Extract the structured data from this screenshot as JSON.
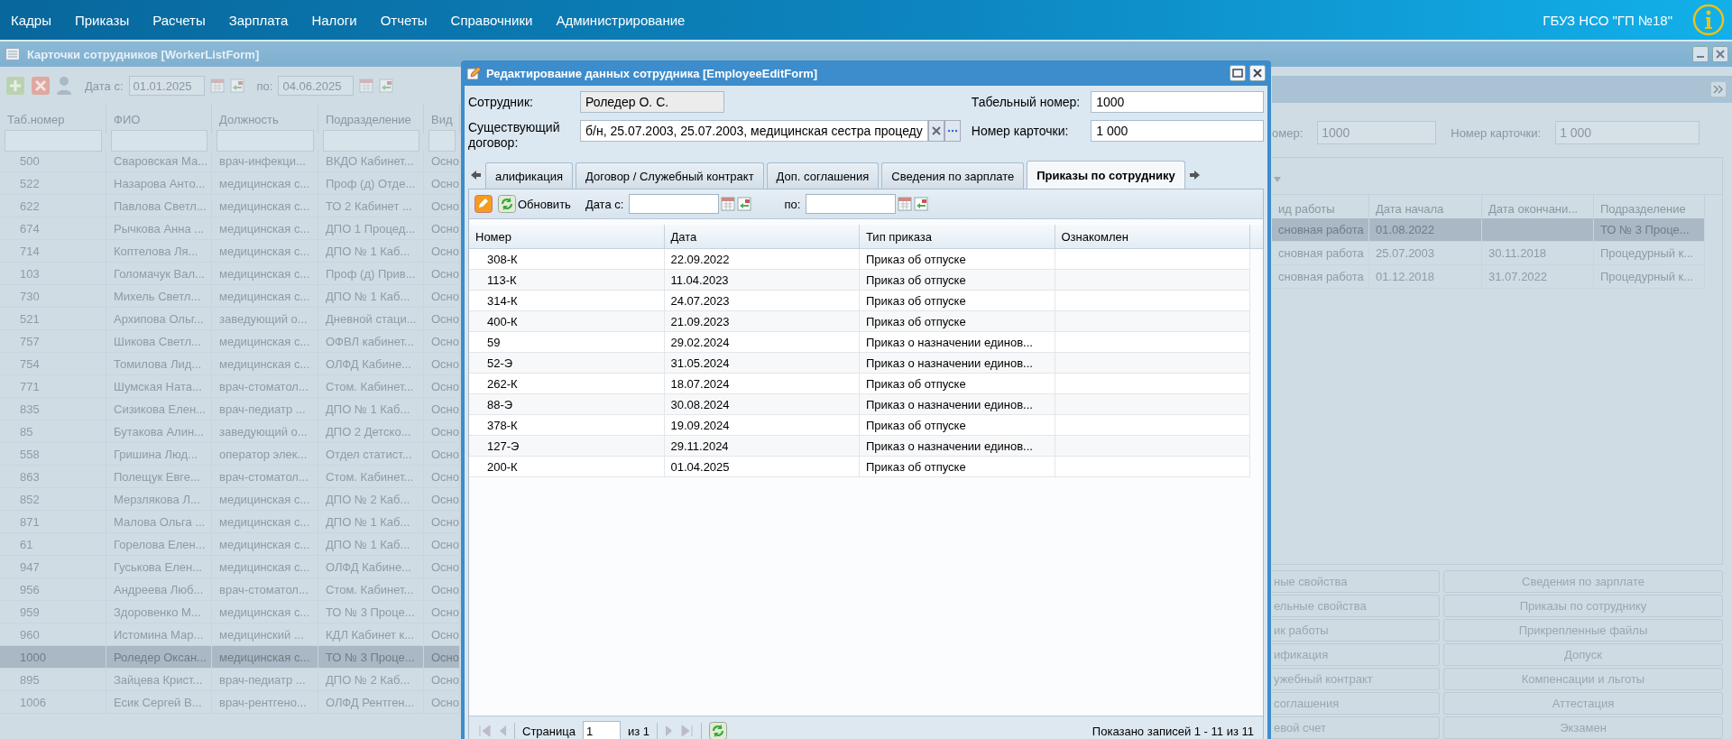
{
  "menu_bar": {
    "items": [
      "Кадры",
      "Приказы",
      "Расчеты",
      "Зарплата",
      "Налоги",
      "Отчеты",
      "Справочники",
      "Администрирование"
    ],
    "organization": "ГБУЗ НСО \"ГП №18\""
  },
  "worker_list_window": {
    "title": "Карточки сотрудников [WorkerListForm]",
    "toolbar": {
      "date_from_label": "Дата с:",
      "date_from": "01.01.2025",
      "date_to_label": "по:",
      "date_to": "04.06.2025"
    },
    "table": {
      "columns": [
        "Таб.номер",
        "ФИО",
        "Должность",
        "Подразделение",
        "Вид"
      ],
      "rows": [
        {
          "cells": [
            "500",
            "Сваровская Ма...",
            "врач-инфекци...",
            "ВКДО Кабинет...",
            "Осно"
          ],
          "selected": false
        },
        {
          "cells": [
            "522",
            "Назарова Анто...",
            "медицинская с...",
            "Проф (д) Отде...",
            "Осно"
          ],
          "selected": false
        },
        {
          "cells": [
            "622",
            "Павлова Светл...",
            "медицинская с...",
            "ТО 2 Кабинет ...",
            "Осно"
          ],
          "selected": false
        },
        {
          "cells": [
            "674",
            "Рычкова Анна ...",
            "медицинская с...",
            "ДПО 1 Процед...",
            "Осно"
          ],
          "selected": false
        },
        {
          "cells": [
            "714",
            "Коптелова Ля...",
            "медицинская с...",
            "ДПО № 1 Каб...",
            "Осно"
          ],
          "selected": false
        },
        {
          "cells": [
            "103",
            "Голомачук Вал...",
            "медицинская с...",
            "Проф (д) Прив...",
            "Осно"
          ],
          "selected": false
        },
        {
          "cells": [
            "730",
            "Михель Светл...",
            "медицинская с...",
            "ДПО № 1 Каб...",
            "Осно"
          ],
          "selected": false
        },
        {
          "cells": [
            "521",
            "Архипова Ольг...",
            "заведующий о...",
            "Дневной стаци...",
            "Осно"
          ],
          "selected": false
        },
        {
          "cells": [
            "757",
            "Шикова Светл...",
            "медицинская с...",
            "ОФВЛ кабинет...",
            "Осно"
          ],
          "selected": false
        },
        {
          "cells": [
            "754",
            "Томилова Лид...",
            "медицинская с...",
            "ОЛФД Кабине...",
            "Осно"
          ],
          "selected": false
        },
        {
          "cells": [
            "771",
            "Шумская Ната...",
            "врач-стоматол...",
            "Стом. Кабинет...",
            "Осно"
          ],
          "selected": false
        },
        {
          "cells": [
            "835",
            "Сизикова Елен...",
            "врач-педиатр ...",
            "ДПО № 1 Каб...",
            "Осно"
          ],
          "selected": false
        },
        {
          "cells": [
            "85",
            "Бутакова Алин...",
            "заведующий о...",
            "ДПО 2 Детско...",
            "Осно"
          ],
          "selected": false
        },
        {
          "cells": [
            "558",
            "Гришина Люд...",
            "оператор элек...",
            "Отдел статист...",
            "Осно"
          ],
          "selected": false
        },
        {
          "cells": [
            "863",
            "Полещук Евге...",
            "врач-стоматол...",
            "Стом. Кабинет...",
            "Осно"
          ],
          "selected": false
        },
        {
          "cells": [
            "852",
            "Мерзлякова Л...",
            "медицинская с...",
            "ДПО № 2 Каб...",
            "Осно"
          ],
          "selected": false
        },
        {
          "cells": [
            "871",
            "Малова Ольга ...",
            "медицинская с...",
            "ДПО № 1 Каб...",
            "Осно"
          ],
          "selected": false
        },
        {
          "cells": [
            "61",
            "Горелова Елен...",
            "медицинская с...",
            "ДПО № 1 Каб...",
            "Осно"
          ],
          "selected": false
        },
        {
          "cells": [
            "947",
            "Гуськова Елен...",
            "медицинская с...",
            "ОЛФД Кабине...",
            "Осно"
          ],
          "selected": false
        },
        {
          "cells": [
            "956",
            "Андреева Люб...",
            "врач-стоматол...",
            "Стом. Кабинет...",
            "Осно"
          ],
          "selected": false
        },
        {
          "cells": [
            "959",
            "Здоровенко М...",
            "медицинская с...",
            "ТО № 3 Проце...",
            "Осно"
          ],
          "selected": false
        },
        {
          "cells": [
            "960",
            "Истомина Мар...",
            "медицинский ...",
            "КДЛ Кабинет к...",
            "Осно"
          ],
          "selected": false
        },
        {
          "cells": [
            "1000",
            "Роледер Оксан...",
            "медицинская с...",
            "ТО № 3 Проце...",
            "Осно"
          ],
          "selected": true
        },
        {
          "cells": [
            "895",
            "Зайцева Крист...",
            "врач-педиатр ...",
            "ДПО № 2 Каб...",
            "Осно"
          ],
          "selected": false
        },
        {
          "cells": [
            "1006",
            "Есик Сергей В...",
            "врач-рентгено...",
            "ОЛФД Рентген...",
            "Осно"
          ],
          "selected": false
        }
      ]
    }
  },
  "details_panel": {
    "fields": [
      {
        "label": "омер:",
        "value": "1000"
      },
      {
        "label": "Номер карточки:",
        "value": "1 000"
      }
    ],
    "table": {
      "columns": [
        "ид работы",
        "Дата начала",
        "Дата окончани...",
        "Подразделение"
      ],
      "rows": [
        {
          "cells": [
            "сновная работа",
            "01.08.2022",
            "",
            "ТО № 3 Проце..."
          ],
          "selected": true
        },
        {
          "cells": [
            "сновная работа",
            "25.07.2003",
            "30.11.2018",
            "Процедурный к..."
          ],
          "selected": false
        },
        {
          "cells": [
            "сновная работа",
            "01.12.2018",
            "31.07.2022",
            "Процедурный к..."
          ],
          "selected": false
        }
      ]
    },
    "buttons": [
      "ные свойства",
      "Сведения по зарплате",
      "ельные свойства",
      "Приказы по сотруднику",
      "ик работы",
      "Прикрепленные файлы",
      "ификация",
      "Допуск",
      "ужебный контракт",
      "Компенсации и льготы",
      "соглашения",
      "Аттестация",
      "евой счет",
      "Экзамен"
    ]
  },
  "edit_dialog": {
    "title": "Редактирование данных сотрудника [EmployeeEditForm]",
    "employee_label": "Сотрудник:",
    "employee": "Роледер О. С.",
    "tab_number_label": "Табельный номер:",
    "tab_number": "1000",
    "contract_label": "Существующий договор:",
    "contract": "б/н, 25.07.2003, 25.07.2003, медицинская сестра процеду",
    "card_number_label": "Номер карточки:",
    "card_number": "1 000",
    "tabs": [
      {
        "label": "алификация",
        "selected": false
      },
      {
        "label": "Договор / Служебный контракт",
        "selected": false
      },
      {
        "label": "Доп. соглашения",
        "selected": false
      },
      {
        "label": "Сведения по зарплате",
        "selected": false
      },
      {
        "label": "Приказы по сотруднику",
        "selected": true
      }
    ],
    "toolbar": {
      "refresh_label": "Обновить",
      "date_from_label": "Дата с:",
      "date_to_label": "по:"
    },
    "table": {
      "columns": [
        "Номер",
        "Дата",
        "Тип приказа",
        "Ознакомлен"
      ],
      "rows": [
        {
          "cells": [
            "308-К",
            "22.09.2022",
            "Приказ об отпуске",
            ""
          ]
        },
        {
          "cells": [
            "113-К",
            "11.04.2023",
            "Приказ об отпуске",
            ""
          ]
        },
        {
          "cells": [
            "314-К",
            "24.07.2023",
            "Приказ об отпуске",
            ""
          ]
        },
        {
          "cells": [
            "400-К",
            "21.09.2023",
            "Приказ об отпуске",
            ""
          ]
        },
        {
          "cells": [
            "59",
            "29.02.2024",
            "Приказ о назначении единов...",
            ""
          ]
        },
        {
          "cells": [
            "52-Э",
            "31.05.2024",
            "Приказ о назначении единов...",
            ""
          ]
        },
        {
          "cells": [
            "262-К",
            "18.07.2024",
            "Приказ об отпуске",
            ""
          ]
        },
        {
          "cells": [
            "88-Э",
            "30.08.2024",
            "Приказ о назначении единов...",
            ""
          ]
        },
        {
          "cells": [
            "378-К",
            "19.09.2024",
            "Приказ об отпуске",
            ""
          ]
        },
        {
          "cells": [
            "127-Э",
            "29.11.2024",
            "Приказ о назначении единов...",
            ""
          ]
        },
        {
          "cells": [
            "200-К",
            "01.04.2025",
            "Приказ об отпуске",
            ""
          ]
        }
      ]
    },
    "pager": {
      "page_label": "Страница",
      "page": "1",
      "of_label": "из 1",
      "summary": "Показано записей 1 - 11 из 11"
    }
  }
}
